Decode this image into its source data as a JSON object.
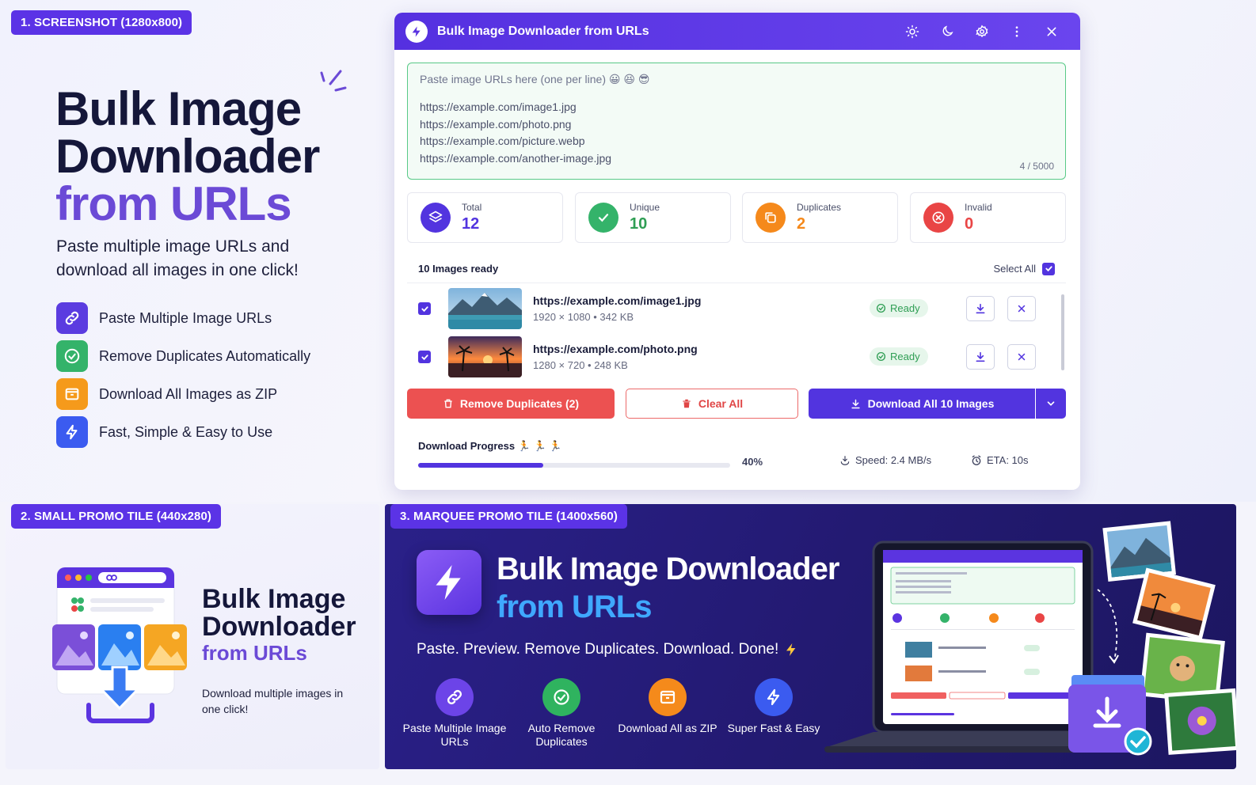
{
  "section1": {
    "tag": "1. SCREENSHOT (1280x800)",
    "title_line1": "Bulk Image",
    "title_line2": "Downloader",
    "title_line3": "from URLs",
    "subtitle": "Paste multiple image URLs and download all images in one click!",
    "features": [
      {
        "label": "Paste Multiple Image URLs",
        "icon": "link-icon",
        "color": "#5b3ce0"
      },
      {
        "label": "Remove Duplicates Automatically",
        "icon": "check-circle-icon",
        "color": "#34b36a"
      },
      {
        "label": "Download All Images as ZIP",
        "icon": "archive-icon",
        "color": "#f59a1b"
      },
      {
        "label": "Fast, Simple & Easy to Use",
        "icon": "bolt-icon",
        "color": "#3b5bf0"
      }
    ]
  },
  "app": {
    "title": "Bulk Image Downloader from URLs",
    "placeholder": "Paste image URLs here (one per line) 😀 😆 😎",
    "urls": [
      "https://example.com/image1.jpg",
      "https://example.com/photo.png",
      "https://example.com/picture.webp",
      "https://example.com/another-image.jpg"
    ],
    "char_count": "4 / 5000",
    "stats": [
      {
        "label": "Total",
        "value": "12",
        "color": "#5234df"
      },
      {
        "label": "Unique",
        "value": "10",
        "color": "#34b36a"
      },
      {
        "label": "Duplicates",
        "value": "2",
        "color": "#f5891b"
      },
      {
        "label": "Invalid",
        "value": "0",
        "color": "#e94545"
      }
    ],
    "list_header": "10 Images ready",
    "select_all": "Select All",
    "images": [
      {
        "url": "https://example.com/image1.jpg",
        "meta": "1920 × 1080   •   342 KB",
        "status": "Ready"
      },
      {
        "url": "https://example.com/photo.png",
        "meta": "1280 × 720   •   248 KB",
        "status": "Ready"
      }
    ],
    "buttons": {
      "remove_duplicates": "Remove Duplicates (2)",
      "clear_all": "Clear All",
      "download_all": "Download All 10 Images"
    },
    "progress": {
      "label": "Download Progress 🏃 🏃 🏃",
      "percent": 40,
      "percent_text": "40%",
      "speed": "Speed: 2.4 MB/s",
      "eta": "ETA: 10s"
    }
  },
  "section2": {
    "tag": "2. SMALL PROMO TILE (440x280)",
    "title_line1": "Bulk Image",
    "title_line2": "Downloader",
    "title_line3": "from URLs",
    "subtitle": "Download multiple images in one click!"
  },
  "section3": {
    "tag": "3. MARQUEE PROMO TILE (1400x560)",
    "title_line1": "Bulk Image Downloader",
    "title_line2": "from URLs",
    "tagline": "Paste. Preview. Remove Duplicates. Download. Done!",
    "features": [
      {
        "label": "Paste Multiple Image URLs",
        "color": "#6c44e8"
      },
      {
        "label": "Auto Remove Duplicates",
        "color": "#2fb35f"
      },
      {
        "label": "Download All as ZIP",
        "color": "#f58a1b"
      },
      {
        "label": "Super Fast & Easy",
        "color": "#3b5bf0"
      }
    ]
  }
}
